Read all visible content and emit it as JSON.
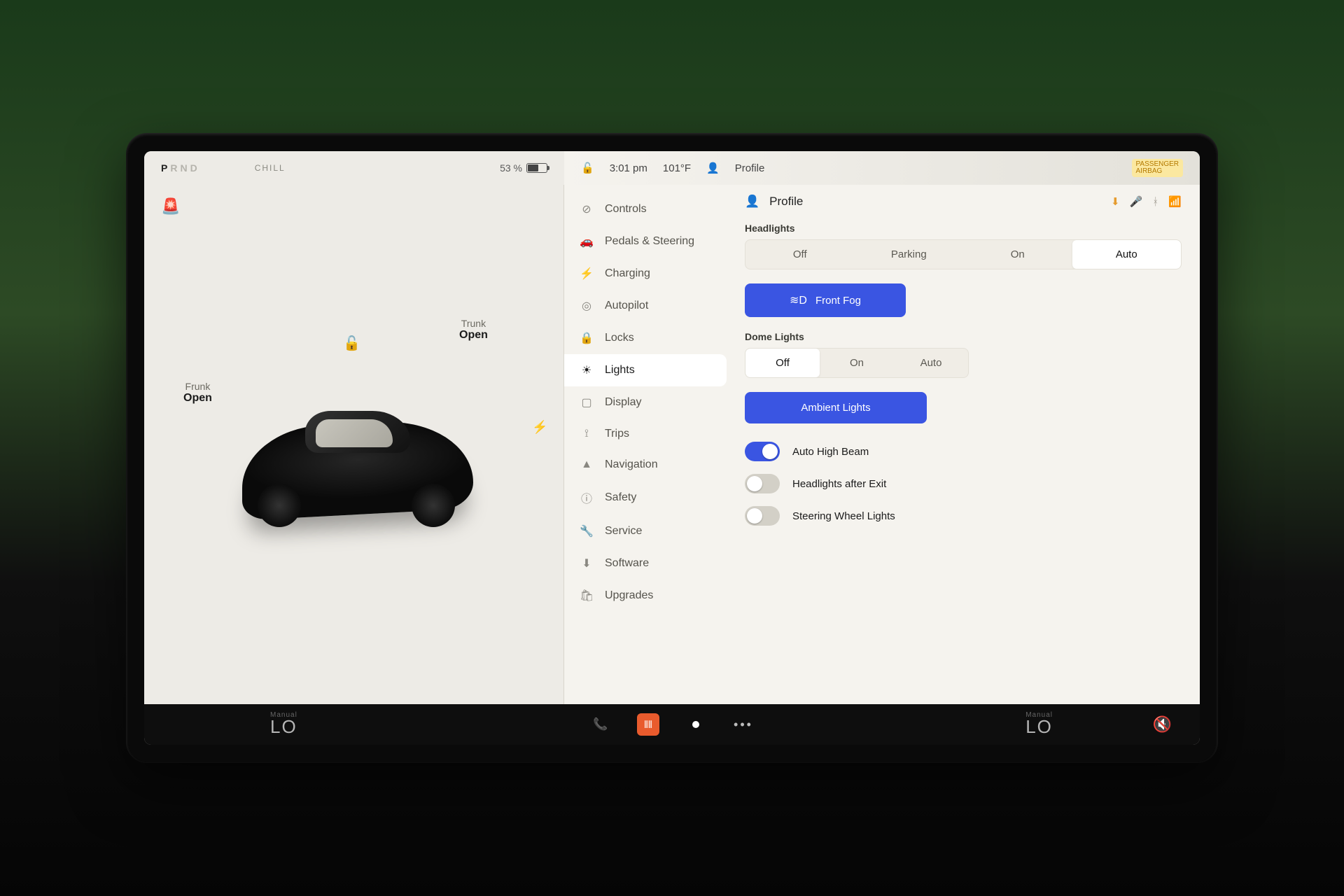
{
  "status": {
    "prnd": {
      "p": "P",
      "r": "R",
      "n": "N",
      "d": "D",
      "active": "P"
    },
    "mode": "CHILL",
    "battery_pct": "53 %",
    "time": "3:01 pm",
    "temp": "101°F",
    "profile_label": "Profile",
    "airbag_line1": "PASSENGER",
    "airbag_line2": "AIRBAG"
  },
  "vehicle": {
    "frunk_label": "Frunk",
    "frunk_action": "Open",
    "trunk_label": "Trunk",
    "trunk_action": "Open"
  },
  "menu": {
    "items": [
      {
        "icon": "⊘",
        "label": "Controls"
      },
      {
        "icon": "🚗",
        "label": "Pedals & Steering"
      },
      {
        "icon": "⚡",
        "label": "Charging"
      },
      {
        "icon": "◎",
        "label": "Autopilot"
      },
      {
        "icon": "🔒",
        "label": "Locks"
      },
      {
        "icon": "☀",
        "label": "Lights"
      },
      {
        "icon": "▢",
        "label": "Display"
      },
      {
        "icon": "⟟",
        "label": "Trips"
      },
      {
        "icon": "▲",
        "label": "Navigation"
      },
      {
        "icon": "ⓘ",
        "label": "Safety"
      },
      {
        "icon": "🔧",
        "label": "Service"
      },
      {
        "icon": "⬇",
        "label": "Software"
      },
      {
        "icon": "🛍",
        "label": "Upgrades"
      }
    ],
    "active_index": 5
  },
  "lights": {
    "profile_label": "Profile",
    "headlights_label": "Headlights",
    "headlights_opts": [
      "Off",
      "Parking",
      "On",
      "Auto"
    ],
    "headlights_selected": 3,
    "front_fog_label": "Front Fog",
    "dome_label": "Dome Lights",
    "dome_opts": [
      "Off",
      "On",
      "Auto"
    ],
    "dome_selected": 0,
    "ambient_label": "Ambient Lights",
    "toggles": [
      {
        "label": "Auto High Beam",
        "on": true
      },
      {
        "label": "Headlights after Exit",
        "on": false
      },
      {
        "label": "Steering Wheel Lights",
        "on": false
      }
    ]
  },
  "dock": {
    "left_mode": "Manual",
    "left_temp": "LO",
    "right_mode": "Manual",
    "right_temp": "LO"
  }
}
